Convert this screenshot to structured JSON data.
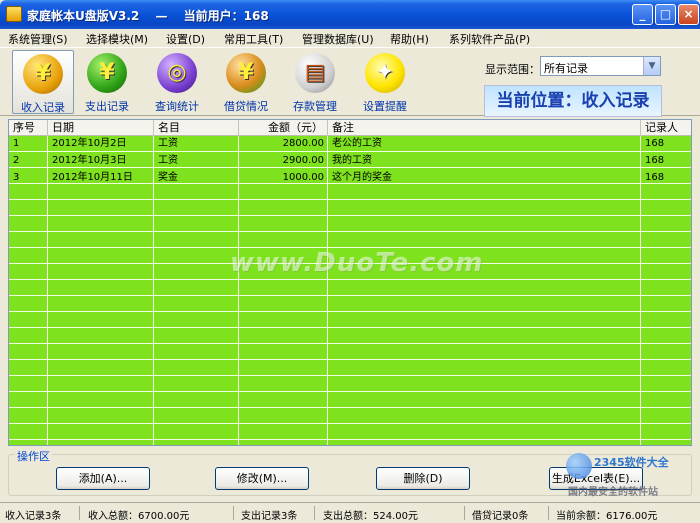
{
  "window": {
    "title": "家庭帐本U盘版V3.2　 —　 当前用户：168",
    "buttons": {
      "minimize": "_",
      "maximize": "□",
      "close": "×"
    }
  },
  "menu": [
    "系统管理(S)",
    "选择模块(M)",
    "设置(D)",
    "常用工具(T)",
    "管理数据库(U)",
    "帮助(H)",
    "系列软件产品(P)"
  ],
  "toolbar": {
    "tools": [
      {
        "label": "收入记录",
        "icon": "yen-coin-income-icon",
        "glyph": "¥",
        "active": true
      },
      {
        "label": "支出记录",
        "icon": "yen-coin-expense-icon",
        "glyph": "¥",
        "active": false
      },
      {
        "label": "查询统计",
        "icon": "magnifier-query-icon",
        "glyph": "◎",
        "active": false
      },
      {
        "label": "借贷情况",
        "icon": "yen-loan-icon",
        "glyph": "¥",
        "active": false
      },
      {
        "label": "存款管理",
        "icon": "bankcard-deposit-icon",
        "glyph": "▤",
        "active": false
      },
      {
        "label": "设置提醒",
        "icon": "lightbulb-reminder-icon",
        "glyph": "✦",
        "active": false
      }
    ],
    "range_label": "显示范围：",
    "range_value": "所有记录",
    "location": "当前位置：收入记录"
  },
  "grid": {
    "columns": [
      "序号",
      "日期",
      "名目",
      "金额（元）",
      "备注",
      "记录人"
    ],
    "rows": [
      [
        "1",
        "2012年10月2日",
        "工资",
        "2800.00",
        "老公的工资",
        "168"
      ],
      [
        "2",
        "2012年10月3日",
        "工资",
        "2900.00",
        "我的工资",
        "168"
      ],
      [
        "3",
        "2012年10月11日",
        "奖金",
        "1000.00",
        "这个月的奖金",
        "168"
      ]
    ]
  },
  "watermark": "www.DuoTe.com",
  "op_area": {
    "legend": "操作区",
    "add": "添加(A)...",
    "edit": "修改(M)...",
    "delete": "删除(D)",
    "excel": "生成Excel表(E)..."
  },
  "site_logo": {
    "top": "2345软件大全",
    "bottom": "国内最安全的软件站"
  },
  "status": [
    "收入记录3条",
    "收入总额：6700.00元",
    "支出记录3条",
    "支出总额：524.00元",
    "借贷记录0条",
    "当前余额：6176.00元"
  ],
  "colors": {
    "grid_bg": "#7fe21e",
    "titlebar": "#0a52d8",
    "location_text": "#1a40b0"
  }
}
